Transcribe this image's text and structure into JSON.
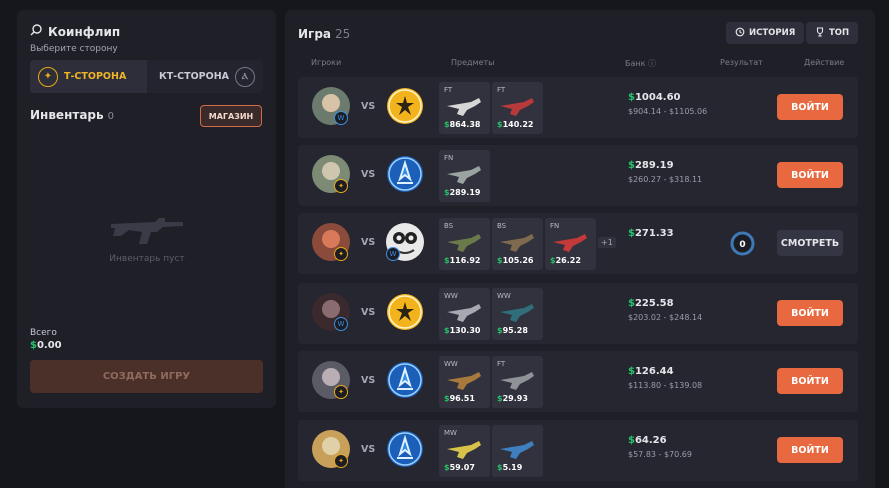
{
  "left": {
    "title": "Коинфлип",
    "subtitle": "Выберите сторону",
    "side_t": "Т-СТОРОНА",
    "side_ct": "КТ-СТОРОНА",
    "inventory_title": "Инвентарь",
    "inventory_count": "0",
    "shop": "МАГАЗИН",
    "inventory_empty": "Инвентарь пуст",
    "total_label": "Всего",
    "total_currency": "$",
    "total_value": "0.00",
    "create": "СОЗДАТЬ ИГРУ"
  },
  "right": {
    "title": "Игра",
    "count": "25",
    "history": "ИСТОРИЯ",
    "top": "ТОП",
    "columns": {
      "players": "Игроки",
      "items": "Предметы",
      "bank": "Банк",
      "result": "Результат",
      "action": "Действие"
    },
    "vs": "VS",
    "currency": "$",
    "rows": [
      {
        "bank": "1004.60",
        "range": "$904.14 - $1105.06",
        "action": "ВОЙТИ",
        "items": [
          {
            "q": "FT",
            "p": "$864.38"
          },
          {
            "q": "FT",
            "p": "$140.22"
          }
        ],
        "more": ""
      },
      {
        "bank": "289.19",
        "range": "$260.27 - $318.11",
        "action": "ВОЙТИ",
        "items": [
          {
            "q": "FN",
            "p": "$289.19"
          }
        ],
        "more": ""
      },
      {
        "bank": "271.33",
        "range": "",
        "action": "СМОТРЕТЬ",
        "result": "0",
        "items": [
          {
            "q": "BS",
            "p": "$116.92"
          },
          {
            "q": "BS",
            "p": "$105.26"
          },
          {
            "q": "FN",
            "p": "$26.22"
          }
        ],
        "more": "+1"
      },
      {
        "bank": "225.58",
        "range": "$203.02 - $248.14",
        "action": "ВОЙТИ",
        "items": [
          {
            "q": "WW",
            "p": "$130.30"
          },
          {
            "q": "WW",
            "p": "$95.28"
          }
        ],
        "more": ""
      },
      {
        "bank": "126.44",
        "range": "$113.80 - $139.08",
        "action": "ВОЙТИ",
        "items": [
          {
            "q": "WW",
            "p": "$96.51"
          },
          {
            "q": "FT",
            "p": "$29.93"
          }
        ],
        "more": ""
      },
      {
        "bank": "64.26",
        "range": "$57.83 - $70.69",
        "action": "ВОЙТИ",
        "items": [
          {
            "q": "MW",
            "p": "$59.07"
          },
          {
            "q": "",
            "p": "$5.19"
          }
        ],
        "more": ""
      }
    ]
  },
  "colors": {
    "accent": "#e8693f",
    "t_gold": "#e8a917",
    "ct_blue": "#3d8fe0",
    "money": "#27c46a"
  }
}
